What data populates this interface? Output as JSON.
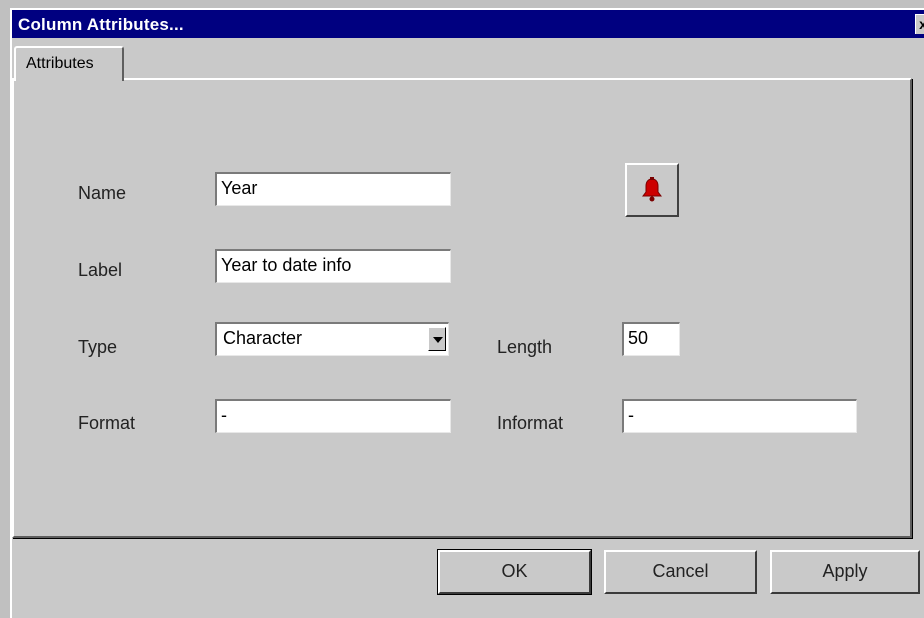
{
  "window": {
    "title": "Column Attributes...",
    "close_label": "x"
  },
  "tabs": [
    {
      "label": "Attributes",
      "selected": true
    }
  ],
  "form": {
    "name_label": "Name",
    "name_value": "Year",
    "label_label": "Label",
    "label_value": "Year to date info",
    "type_label": "Type",
    "type_value": "Character",
    "length_label": "Length",
    "length_value": "50",
    "format_label": "Format",
    "format_value": "-",
    "informat_label": "Informat",
    "informat_value": "-"
  },
  "icons": {
    "bell": "bell-icon",
    "bell_color": "#cc0000"
  },
  "buttons": {
    "ok": "OK",
    "cancel": "Cancel",
    "apply": "Apply"
  }
}
